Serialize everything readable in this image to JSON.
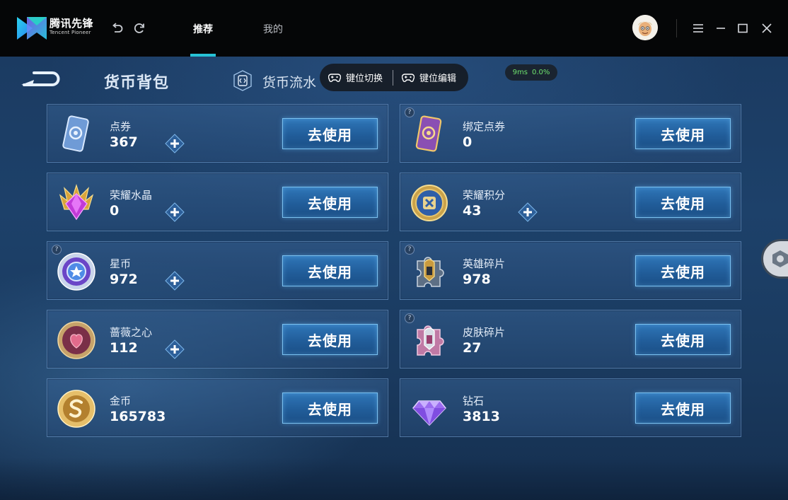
{
  "titlebar": {
    "brand_cn": "腾讯先锋",
    "brand_en": "Tencent Pioneer",
    "tabs": [
      {
        "label": "推荐",
        "active": true
      },
      {
        "label": "我的",
        "active": false
      }
    ],
    "accent_color": "#27c2d6"
  },
  "game": {
    "title": "货币背包",
    "flow_label": "货币流水",
    "keypill": {
      "switch_label": "键位切换",
      "edit_label": "键位编辑"
    },
    "ping": {
      "latency": "9ms",
      "loss": "0.0%"
    },
    "button_label": "去使用",
    "currencies": [
      {
        "name": "点券",
        "value": "367",
        "icon": "voucher-card-icon",
        "plus": true,
        "help": false
      },
      {
        "name": "绑定点券",
        "value": "0",
        "icon": "bound-voucher-card-icon",
        "plus": false,
        "help": true
      },
      {
        "name": "荣耀水晶",
        "value": "0",
        "icon": "glory-crystal-icon",
        "plus": true,
        "help": false
      },
      {
        "name": "荣耀积分",
        "value": "43",
        "icon": "glory-points-coin-icon",
        "plus": true,
        "help": false
      },
      {
        "name": "星币",
        "value": "972",
        "icon": "star-coin-icon",
        "plus": true,
        "help": true
      },
      {
        "name": "英雄碎片",
        "value": "978",
        "icon": "hero-fragment-icon",
        "plus": false,
        "help": true
      },
      {
        "name": "蔷薇之心",
        "value": "112",
        "icon": "rose-heart-icon",
        "plus": true,
        "help": false
      },
      {
        "name": "皮肤碎片",
        "value": "27",
        "icon": "skin-fragment-icon",
        "plus": false,
        "help": true
      },
      {
        "name": "金币",
        "value": "165783",
        "icon": "gold-coin-icon",
        "plus": false,
        "help": false
      },
      {
        "name": "钻石",
        "value": "3813",
        "icon": "diamond-icon",
        "plus": false,
        "help": false
      }
    ]
  }
}
